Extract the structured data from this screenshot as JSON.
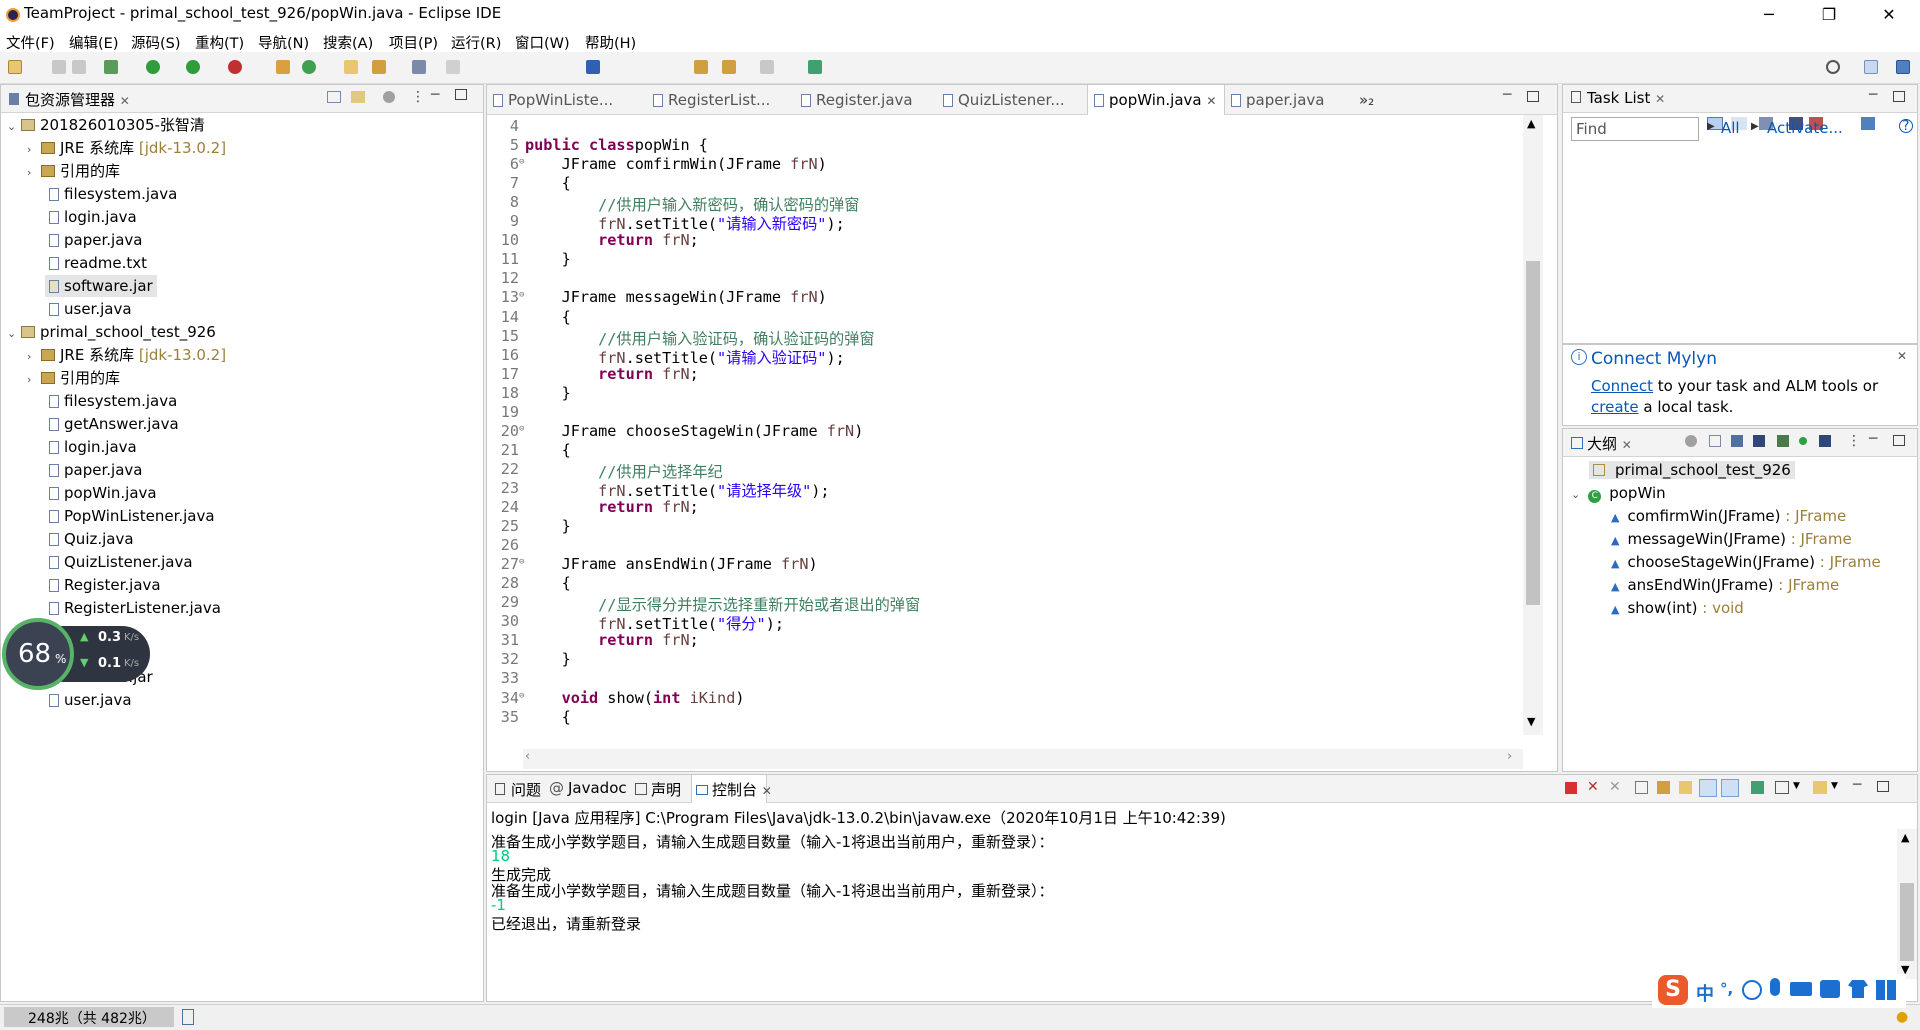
{
  "window": {
    "title": "TeamProject - primal_school_test_926/popWin.java - Eclipse IDE",
    "minimize": "─",
    "restore": "❐",
    "close": "✕"
  },
  "menu": [
    "文件(F)",
    "编辑(E)",
    "源码(S)",
    "重构(T)",
    "导航(N)",
    "搜索(A)",
    "项目(P)",
    "运行(R)",
    "窗口(W)",
    "帮助(H)"
  ],
  "package_explorer": {
    "tab": "包资源管理器",
    "project1": {
      "name": "201826010305-张智清",
      "jre": "JRE 系统库",
      "jre_version": "[jdk-13.0.2]",
      "libs": "引用的库",
      "files": [
        "filesystem.java",
        "login.java",
        "paper.java",
        "readme.txt",
        "software.jar",
        "user.java"
      ]
    },
    "project2": {
      "name": "primal_school_test_926",
      "jre": "JRE 系统库",
      "jre_version": "[jdk-13.0.2]",
      "libs": "引用的库",
      "files": [
        "filesystem.java",
        "getAnswer.java",
        "login.java",
        "paper.java",
        "popWin.java",
        "PopWinListener.java",
        "Quiz.java",
        "QuizListener.java",
        "Register.java",
        "RegisterListener.java"
      ],
      "files_after": [
        "software.jar",
        "user.java"
      ]
    }
  },
  "net_widget": {
    "percent": "68",
    "pct_sign": "%",
    "up": "0.3",
    "down": "0.1",
    "unit": "K/s"
  },
  "editor": {
    "tabs": [
      "PopWinListe...",
      "RegisterList...",
      "Register.java",
      "QuizListener...",
      "popWin.java",
      "paper.java"
    ],
    "active_tab": "popWin.java",
    "overflow": "»₂",
    "lines": [
      {
        "n": "4",
        "parts": []
      },
      {
        "n": "5",
        "parts": [
          [
            "kw",
            "public class"
          ],
          [
            "",
            "popWin {"
          ]
        ]
      },
      {
        "n": "6",
        "fold": true,
        "parts": [
          [
            "",
            "    JFrame comfirmWin(JFrame "
          ],
          [
            "fn",
            "frN"
          ],
          [
            "",
            ")"
          ]
        ]
      },
      {
        "n": "7",
        "parts": [
          [
            "",
            "    {"
          ]
        ]
      },
      {
        "n": "8",
        "parts": [
          [
            "cm",
            "        //供用户输入新密码，确认密码的弹窗"
          ]
        ]
      },
      {
        "n": "9",
        "parts": [
          [
            "fn",
            "        frN"
          ],
          [
            "",
            ".setTitle("
          ],
          [
            "st",
            "\"请输入新密码\""
          ],
          [
            "",
            ");"
          ]
        ]
      },
      {
        "n": "10",
        "parts": [
          [
            "kw",
            "        return"
          ],
          [
            "",
            " "
          ],
          [
            "fn",
            "frN"
          ],
          [
            "",
            ";"
          ]
        ]
      },
      {
        "n": "11",
        "parts": [
          [
            "",
            "    }"
          ]
        ]
      },
      {
        "n": "12",
        "parts": []
      },
      {
        "n": "13",
        "fold": true,
        "parts": [
          [
            "",
            "    JFrame messageWin(JFrame "
          ],
          [
            "fn",
            "frN"
          ],
          [
            "",
            ")"
          ]
        ]
      },
      {
        "n": "14",
        "parts": [
          [
            "",
            "    {"
          ]
        ]
      },
      {
        "n": "15",
        "parts": [
          [
            "cm",
            "        //供用户输入验证码，确认验证码的弹窗"
          ]
        ]
      },
      {
        "n": "16",
        "parts": [
          [
            "fn",
            "        frN"
          ],
          [
            "",
            ".setTitle("
          ],
          [
            "st",
            "\"请输入验证码\""
          ],
          [
            "",
            ");"
          ]
        ]
      },
      {
        "n": "17",
        "parts": [
          [
            "kw",
            "        return"
          ],
          [
            "",
            " "
          ],
          [
            "fn",
            "frN"
          ],
          [
            "",
            ";"
          ]
        ]
      },
      {
        "n": "18",
        "parts": [
          [
            "",
            "    }"
          ]
        ]
      },
      {
        "n": "19",
        "parts": []
      },
      {
        "n": "20",
        "fold": true,
        "parts": [
          [
            "",
            "    JFrame chooseStageWin(JFrame "
          ],
          [
            "fn",
            "frN"
          ],
          [
            "",
            ")"
          ]
        ]
      },
      {
        "n": "21",
        "parts": [
          [
            "",
            "    {"
          ]
        ]
      },
      {
        "n": "22",
        "parts": [
          [
            "cm",
            "        //供用户选择年纪"
          ]
        ]
      },
      {
        "n": "23",
        "parts": [
          [
            "fn",
            "        frN"
          ],
          [
            "",
            ".setTitle("
          ],
          [
            "st",
            "\"请选择年级\""
          ],
          [
            "",
            ");"
          ]
        ]
      },
      {
        "n": "24",
        "parts": [
          [
            "kw",
            "        return"
          ],
          [
            "",
            " "
          ],
          [
            "fn",
            "frN"
          ],
          [
            "",
            ";"
          ]
        ]
      },
      {
        "n": "25",
        "parts": [
          [
            "",
            "    }"
          ]
        ]
      },
      {
        "n": "26",
        "parts": []
      },
      {
        "n": "27",
        "fold": true,
        "parts": [
          [
            "",
            "    JFrame ansEndWin(JFrame "
          ],
          [
            "fn",
            "frN"
          ],
          [
            "",
            ")"
          ]
        ]
      },
      {
        "n": "28",
        "parts": [
          [
            "",
            "    {"
          ]
        ]
      },
      {
        "n": "29",
        "parts": [
          [
            "cm",
            "        //显示得分并提示选择重新开始或者退出的弹窗"
          ]
        ]
      },
      {
        "n": "30",
        "parts": [
          [
            "fn",
            "        frN"
          ],
          [
            "",
            ".setTitle("
          ],
          [
            "st",
            "\"得分\""
          ],
          [
            "",
            ");"
          ]
        ]
      },
      {
        "n": "31",
        "parts": [
          [
            "kw",
            "        return"
          ],
          [
            "",
            " "
          ],
          [
            "fn",
            "frN"
          ],
          [
            "",
            ";"
          ]
        ]
      },
      {
        "n": "32",
        "parts": [
          [
            "",
            "    }"
          ]
        ]
      },
      {
        "n": "33",
        "parts": []
      },
      {
        "n": "34",
        "fold": true,
        "parts": [
          [
            "kw",
            "    void"
          ],
          [
            "",
            " show("
          ],
          [
            "kw",
            "int"
          ],
          [
            "",
            " "
          ],
          [
            "fn",
            "iKind"
          ],
          [
            "",
            ")"
          ]
        ]
      },
      {
        "n": "35",
        "parts": [
          [
            "",
            "    {"
          ]
        ]
      }
    ]
  },
  "task_list": {
    "tab": "Task List",
    "find_placeholder": "Find",
    "all": "All",
    "activate": "Activate...",
    "help": "?"
  },
  "mylyn": {
    "title": "Connect Mylyn",
    "connect": "Connect",
    "text1": " to your task and ALM tools or",
    "create": "create",
    "text2": " a local task."
  },
  "outline": {
    "tab": "大纲",
    "package": "primal_school_test_926",
    "class": "popWin",
    "methods": [
      {
        "name": "comfirmWin(JFrame)",
        "ret": " : JFrame"
      },
      {
        "name": "messageWin(JFrame)",
        "ret": " : JFrame"
      },
      {
        "name": "chooseStageWin(JFrame)",
        "ret": " : JFrame"
      },
      {
        "name": "ansEndWin(JFrame)",
        "ret": " : JFrame"
      },
      {
        "name": "show(int)",
        "ret": " : void"
      }
    ]
  },
  "bottom_tabs": [
    "问题",
    "Javadoc",
    "声明",
    "控制台"
  ],
  "console": {
    "header": "login [Java 应用程序] C:\\Program Files\\Java\\jdk-13.0.2\\bin\\javaw.exe（2020年10月1日 上午10:42:39)",
    "lines": [
      {
        "text": "准备生成小学数学题目，请输入生成题目数量（输入-1将退出当前用户，重新登录）：",
        "color": "#000000"
      },
      {
        "text": "18",
        "color": "#00c87d"
      },
      {
        "text": "生成完成",
        "color": "#000000"
      },
      {
        "text": "准备生成小学数学题目，请输入生成题目数量（输入-1将退出当前用户，重新登录）：",
        "color": "#000000"
      },
      {
        "text": "-1",
        "color": "#00c87d"
      },
      {
        "text": "已经退出，请重新登录",
        "color": "#000000"
      }
    ]
  },
  "status": {
    "memory": "248兆（共 482兆）"
  },
  "ime": {
    "logo": "S",
    "lang": "中",
    "punct": "°,"
  },
  "colors": {
    "keyword": "#7f0055",
    "comment": "#3f7f5f",
    "string": "#2a00ff",
    "link": "#0a57b5",
    "input": "#00c87d"
  }
}
